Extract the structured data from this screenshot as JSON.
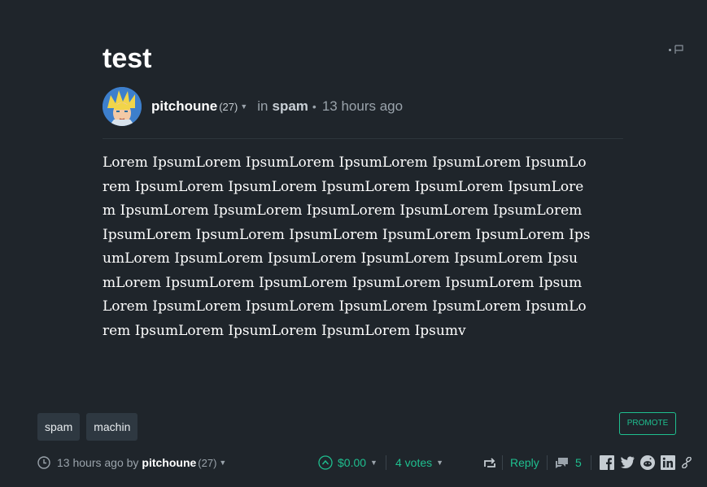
{
  "post": {
    "title": "test",
    "author": "pitchoune",
    "reputation": "(27)",
    "in_label": "in",
    "category": "spam",
    "time": "13 hours ago",
    "body": "Lorem IpsumLorem IpsumLorem IpsumLorem IpsumLorem IpsumLorem IpsumLorem IpsumLorem IpsumLorem IpsumLorem IpsumLorem IpsumLorem IpsumLorem IpsumLorem IpsumLorem IpsumLorem IpsumLorem IpsumLorem IpsumLorem IpsumLorem IpsumLorem IpsumLorem IpsumLorem IpsumLorem IpsumLorem IpsumLorem IpsumLorem IpsumLorem IpsumLorem IpsumLorem IpsumLorem IpsumLorem IpsumLorem IpsumLorem IpsumLorem IpsumLorem IpsumLorem IpsumLorem IpsumLorem IpsumLorem Ipsumv"
  },
  "tags": [
    "spam",
    "machin"
  ],
  "promote_label": "PROMOTE",
  "footer": {
    "time_text": "13 hours ago by",
    "author": "pitchoune",
    "reputation": "(27)",
    "payout": "$0.00",
    "votes": "4 votes",
    "reply_label": "Reply",
    "comments_count": "5"
  },
  "icons": {
    "flag": "flag-icon",
    "clock": "clock-icon",
    "upvote": "upvote-icon",
    "resteem": "resteem-icon",
    "comments": "comments-icon",
    "share": [
      "facebook-icon",
      "twitter-icon",
      "reddit-icon",
      "linkedin-icon",
      "link-icon"
    ]
  },
  "colors": {
    "background": "#1f252b",
    "accent": "#1fbf8f",
    "tag_bg": "#2e3841",
    "muted_text": "#9aa3ab"
  }
}
